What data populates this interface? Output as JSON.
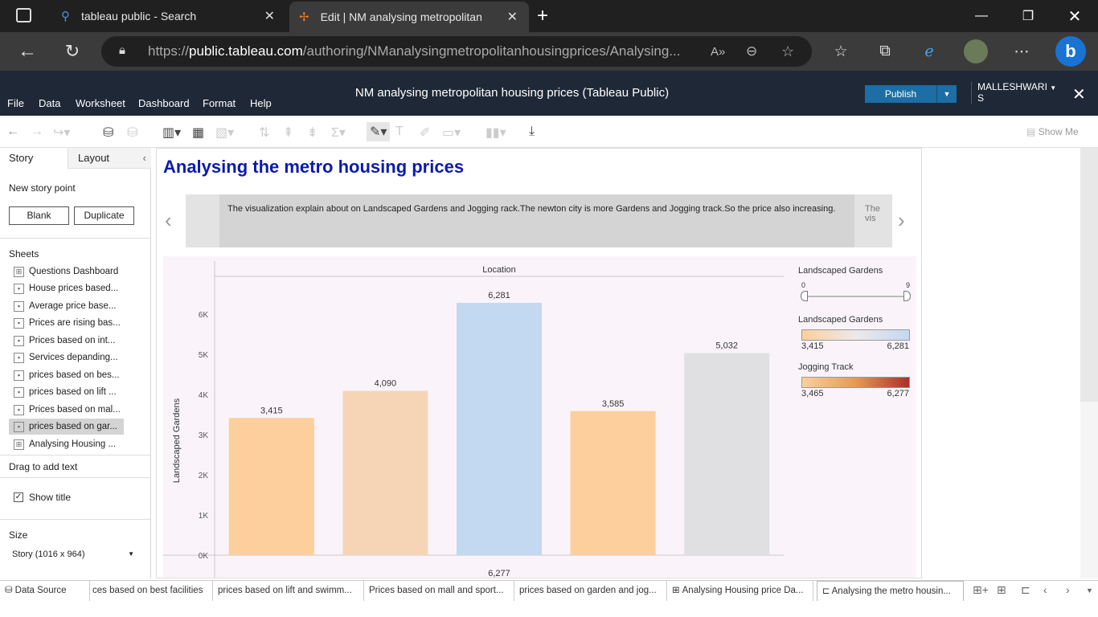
{
  "browser": {
    "tab1": "tableau public - Search",
    "tab2": "Edit | NM analysing metropolitan",
    "url_host": "public.tableau.com",
    "url_rest": "/authoring/NManalysingmetropolitanhousingprices/Analysing...",
    "url_scheme": "https://"
  },
  "app": {
    "menu": [
      "File",
      "Data",
      "Worksheet",
      "Dashboard",
      "Format",
      "Help"
    ],
    "title": "NM analysing metropolitan housing prices (Tableau Public)",
    "publish": "Publish",
    "user": "MALLESHWARI",
    "user2": "S",
    "show_me": "Show Me"
  },
  "left": {
    "tab_story": "Story",
    "tab_layout": "Layout",
    "new_story_point": "New story point",
    "blank": "Blank",
    "duplicate": "Duplicate",
    "sheets_label": "Sheets",
    "sheets": [
      "Questions Dashboard",
      "House prices based...",
      "Average price base...",
      "Prices are rising bas...",
      "Prices based on int...",
      "Services depanding...",
      "prices based on bes...",
      "prices based on lift ...",
      "Prices based on mal...",
      "prices based on gar...",
      "Analysing Housing ..."
    ],
    "drag_text": "Drag to add text",
    "show_title": "Show title",
    "size_label": "Size",
    "size_value": "Story (1016 x 964)"
  },
  "story": {
    "title": "Analysing the metro housing prices",
    "caption": "The visualization explain about on Landscaped Gardens and Jogging rack.The newton city is more Gardens and Jogging track.So the price also increasing.",
    "next_caption": "The vis"
  },
  "legend": {
    "filter_title": "Landscaped Gardens",
    "filter_min": "0",
    "filter_max": "9",
    "color1_title": "Landscaped Gardens",
    "color1_min": "3,415",
    "color1_max": "6,281",
    "color2_title": "Jogging Track",
    "color2_min": "3,465",
    "color2_max": "6,277"
  },
  "chart_data": {
    "type": "bar",
    "header": "Location",
    "ylabel": "Landscaped Gardens",
    "ylim": [
      0,
      6500
    ],
    "yticks": [
      "0K",
      "1K",
      "2K",
      "3K",
      "4K",
      "5K",
      "6K"
    ],
    "values": [
      3415,
      4090,
      6281,
      3585,
      5032
    ],
    "labels": [
      "3,415",
      "4,090",
      "6,281",
      "3,585",
      "5,032"
    ],
    "colors": [
      "#fccf9c",
      "#f6d5b6",
      "#c3d8f1",
      "#fccf9c",
      "#e0e0e2"
    ],
    "lower_label": "6,277"
  },
  "bottom_tabs": [
    "Data Source",
    "ces based on best facilities",
    "prices based on lift and swimm...",
    "Prices based on mall and sport...",
    "prices based on garden and jog...",
    "Analysing Housing price Da...",
    "Analysing the metro housin..."
  ]
}
